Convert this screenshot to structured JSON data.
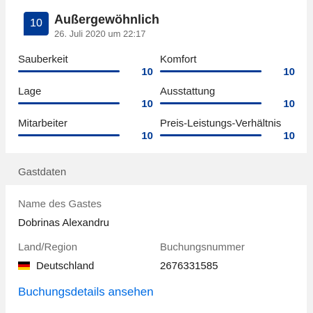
{
  "review": {
    "score": "10",
    "rating_word": "Außergewöhnlich",
    "date": "26. Juli 2020 um 22:17",
    "categories": [
      {
        "label": "Sauberkeit",
        "score": "10",
        "fraction": 1.0
      },
      {
        "label": "Komfort",
        "score": "10",
        "fraction": 1.0
      },
      {
        "label": "Lage",
        "score": "10",
        "fraction": 1.0
      },
      {
        "label": "Ausstattung",
        "score": "10",
        "fraction": 1.0
      },
      {
        "label": "Mitarbeiter",
        "score": "10",
        "fraction": 1.0
      },
      {
        "label": "Preis-Leistungs-Verhältnis",
        "score": "10",
        "fraction": 1.0
      }
    ]
  },
  "guest_section": {
    "title": "Gastdaten",
    "name_label": "Name des Gastes",
    "name_value": "Dobrinas Alexandru",
    "country_label": "Land/Region",
    "country_value": "Deutschland",
    "booking_label": "Buchungsnummer",
    "booking_value": "2676331585",
    "details_link": "Buchungsdetails ansehen"
  },
  "colors": {
    "brand_blue": "#003b95",
    "link_blue": "#006ce4",
    "flag": [
      "#000000",
      "#dd0000",
      "#ffce00"
    ]
  }
}
